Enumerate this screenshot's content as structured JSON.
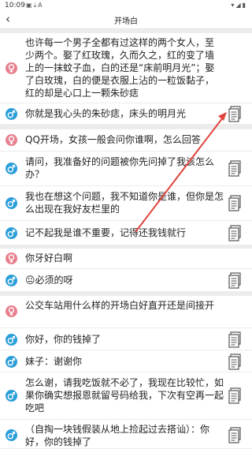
{
  "status_bar": {
    "time": "10:09",
    "left_icons": [
      "image-icon",
      "download-icon",
      "a-icon"
    ],
    "right_icons": [
      "wifi-icon",
      "signal-icon",
      "battery-icon"
    ]
  },
  "header": {
    "back_icon": "chevron-left-icon",
    "title": "开场白"
  },
  "colors": {
    "female": "#e97f8d",
    "male": "#2a9ed8",
    "arrow": "#e0443e",
    "background": "#ececec"
  },
  "conversations": [
    {
      "lines": [
        {
          "gender": "female",
          "text": "也许每一个男子全都有过这样的两个女人，至少两个。娶了红玫瑰，久而久之，红的变了墙上的一抹蚊子血，白的还是“床前明月光”；娶了白玫瑰，白的便是衣服上沾的一粒饭黏子，红的却是心口上一颗朱砂痣"
        },
        {
          "gender": "male",
          "text": "你就是我心头的朱砂痣，床头的明月光"
        }
      ]
    },
    {
      "lines": [
        {
          "gender": "female",
          "text": "QQ开场，女孩一般会问你谁啊，怎么回答"
        },
        {
          "gender": "male",
          "text": "请问，我准备好的问题被你先问掉了我该怎么办？"
        },
        {
          "gender": "male",
          "text": "我也在想这个问题，我不知道你是谁，但你是怎么出现在我好友栏里的"
        },
        {
          "gender": "male",
          "text": "记不起我是谁不重要，记得还我钱就行"
        }
      ]
    },
    {
      "lines": [
        {
          "gender": "female",
          "text": "你牙好白啊"
        },
        {
          "gender": "male",
          "text": "😐必须的呀"
        }
      ]
    },
    {
      "lines": [
        {
          "gender": "female",
          "text": "公交车站用什么样的开场白好直开还是间接开"
        },
        {
          "gender": "male",
          "text": "你好，你的钱掉了"
        },
        {
          "gender": "male",
          "text": "妹子：谢谢你"
        },
        {
          "gender": "male",
          "text": "怎么谢，请我吃饭就不必了，我现在比较忙，如果你确实想报恩就留号码给我，下次有空再一起吃吧"
        },
        {
          "gender": "male",
          "text": "（自掏一块钱假装从地上捡起过去搭讪）：你好，你的钱掉了"
        }
      ]
    }
  ]
}
